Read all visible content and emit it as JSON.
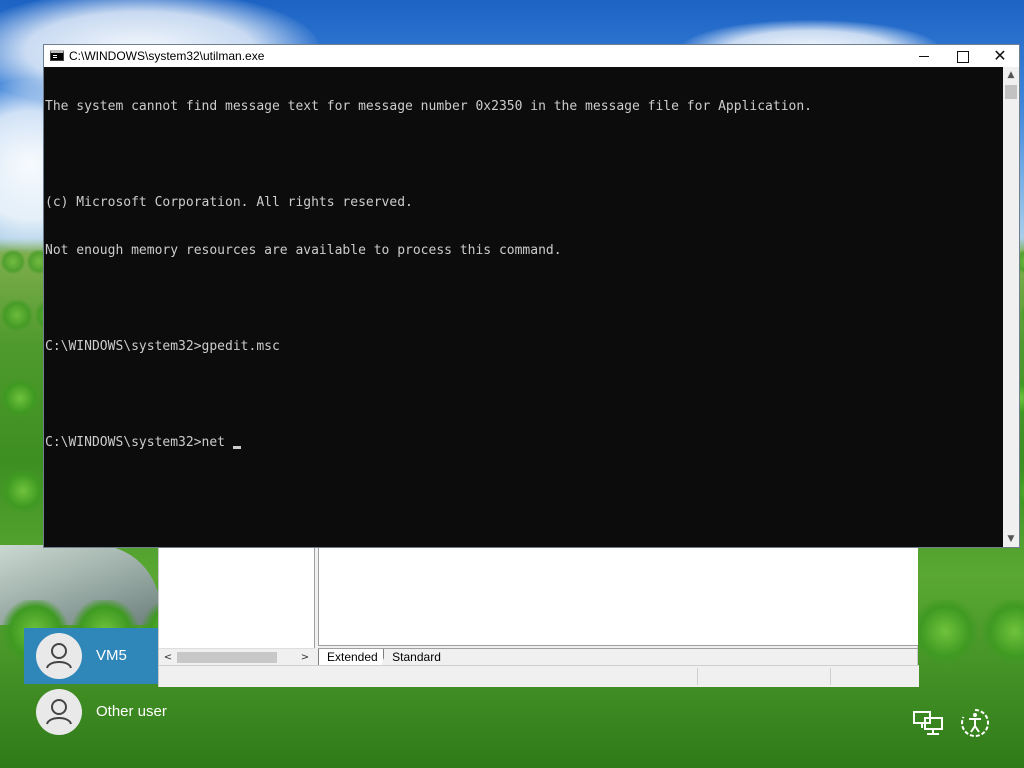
{
  "console": {
    "title": "C:\\WINDOWS\\system32\\utilman.exe",
    "lines": [
      "The system cannot find message text for message number 0x2350 in the message file for Application.",
      "",
      "(c) Microsoft Corporation. All rights reserved.",
      "Not enough memory resources are available to process this command.",
      "",
      "C:\\WINDOWS\\system32>gpedit.msc",
      "",
      "C:\\WINDOWS\\system32>net "
    ],
    "controls": {
      "minimize": "minimize-icon",
      "maximize": "maximize-icon",
      "close": "✕"
    },
    "colors": {
      "background": "#0c0c0c",
      "text": "#cccccc"
    }
  },
  "background_window": {
    "tabs": [
      "Extended",
      "Standard"
    ],
    "scroll_left": "<",
    "scroll_right": ">"
  },
  "users": [
    {
      "name": "VM5",
      "selected": true
    },
    {
      "name": "Other user",
      "selected": false
    }
  ],
  "system_icons": [
    "network-icon",
    "ease-of-access-icon"
  ],
  "accent_color": "#2f86b8"
}
